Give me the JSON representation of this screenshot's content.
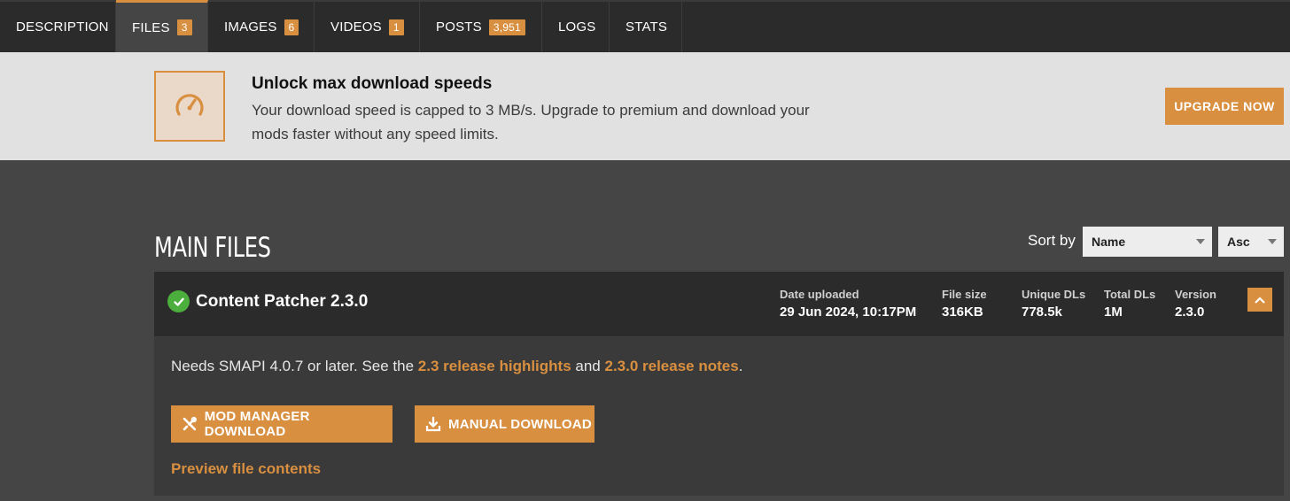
{
  "tabs": [
    {
      "label": "DESCRIPTION",
      "count": null
    },
    {
      "label": "FILES",
      "count": "3"
    },
    {
      "label": "IMAGES",
      "count": "6"
    },
    {
      "label": "VIDEOS",
      "count": "1"
    },
    {
      "label": "POSTS",
      "count": "3,951"
    },
    {
      "label": "LOGS",
      "count": null
    },
    {
      "label": "STATS",
      "count": null
    }
  ],
  "banner": {
    "icon": "speedometer-icon",
    "title": "Unlock max download speeds",
    "description": "Your download speed is capped to 3 MB/s. Upgrade to premium and download your mods faster without any speed limits.",
    "button": "UPGRADE NOW"
  },
  "section": {
    "title": "MAIN FILES",
    "sort_label": "Sort by",
    "sort_field": "Name",
    "sort_order": "Asc"
  },
  "file": {
    "name": "Content Patcher 2.3.0",
    "stats": {
      "date_label": "Date uploaded",
      "date": "29 Jun 2024, 10:17PM",
      "size_label": "File size",
      "size": "316KB",
      "unique_label": "Unique DLs",
      "unique": "778.5k",
      "total_label": "Total DLs",
      "total": "1M",
      "version_label": "Version",
      "version": "2.3.0"
    },
    "req_prefix": "Needs SMAPI 4.0.7 or later. See the ",
    "req_link1": "2.3 release highlights",
    "req_mid": " and ",
    "req_link2": "2.3.0 release notes",
    "req_suffix": ".",
    "mod_manager_button": "MOD MANAGER DOWNLOAD",
    "manual_button": "MANUAL DOWNLOAD",
    "preview_link": "Preview file contents"
  },
  "colors": {
    "accent": "#d98f40",
    "success": "#4cae3c",
    "dark": "#2b2b2b",
    "page": "#454545"
  }
}
